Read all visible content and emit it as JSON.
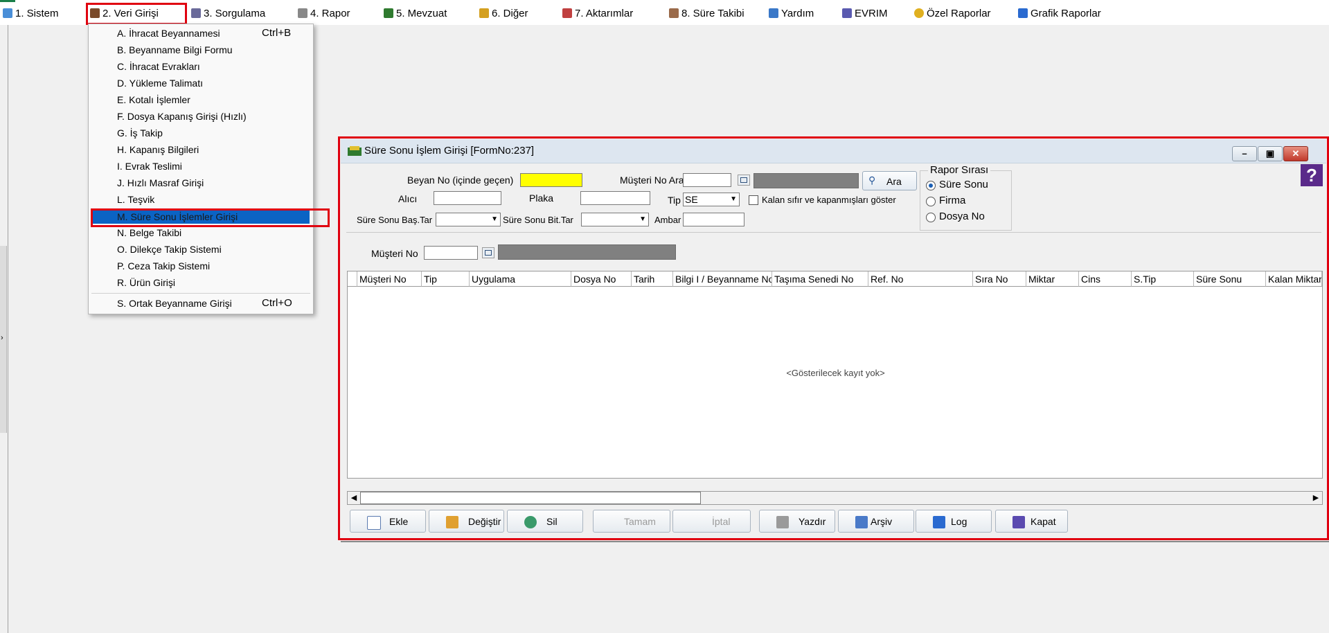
{
  "menubar": {
    "items": [
      {
        "label": "1.   Sistem",
        "icon": "system-icon"
      },
      {
        "label": "2.   Veri Girişi",
        "icon": "data-entry-icon"
      },
      {
        "label": "3.   Sorgulama",
        "icon": "query-icon"
      },
      {
        "label": "4.   Rapor",
        "icon": "printer-icon"
      },
      {
        "label": "5.   Mevzuat",
        "icon": "books-icon"
      },
      {
        "label": "6.   Diğer",
        "icon": "other-icon"
      },
      {
        "label": "7.   Aktarımlar",
        "icon": "transfer-icon"
      },
      {
        "label": "8. Süre Takibi",
        "icon": "calendar-icon"
      },
      {
        "label": "Yardım",
        "icon": "help-icon"
      },
      {
        "label": "EVRIM",
        "icon": "evrim-icon"
      },
      {
        "label": "Özel Raporlar",
        "icon": "star-icon"
      },
      {
        "label": "Grafik Raporlar",
        "icon": "chart-icon"
      }
    ],
    "active_index": 1
  },
  "dropdown": {
    "items": [
      {
        "label": "A.   İhracat Beyannamesi",
        "shortcut": "Ctrl+B"
      },
      {
        "label": "B.   Beyanname Bilgi Formu",
        "shortcut": ""
      },
      {
        "label": "C.   İhracat Evrakları",
        "shortcut": ""
      },
      {
        "label": "D.   Yükleme Talimatı",
        "shortcut": ""
      },
      {
        "label": "E.   Kotalı İşlemler",
        "shortcut": ""
      },
      {
        "label": "F.   Dosya Kapanış Girişi (Hızlı)",
        "shortcut": ""
      },
      {
        "label": "G.   İş Takip",
        "shortcut": ""
      },
      {
        "label": "H.   Kapanış Bilgileri",
        "shortcut": ""
      },
      {
        "label": "I.   Evrak Teslimi",
        "shortcut": ""
      },
      {
        "label": "J.   Hızlı Masraf Girişi",
        "shortcut": ""
      },
      {
        "label": "L.   Teşvik",
        "shortcut": ""
      },
      {
        "label": "M.   Süre Sonu İşlemler Girişi",
        "shortcut": ""
      },
      {
        "label": "N.   Belge Takibi",
        "shortcut": ""
      },
      {
        "label": "O.   Dilekçe Takip Sistemi",
        "shortcut": ""
      },
      {
        "label": "P.   Ceza Takip Sistemi",
        "shortcut": ""
      },
      {
        "label": "R.   Ürün Girişi",
        "shortcut": ""
      },
      {
        "label": "S.   Ortak Beyanname Girişi",
        "shortcut": "Ctrl+O"
      }
    ],
    "selected_index": 11
  },
  "window": {
    "title": "Süre Sonu İşlem Girişi [FormNo:237]",
    "controls": {
      "minimize": "–",
      "maximize": "▣",
      "close": "✕"
    },
    "form": {
      "beyan_no_label": "Beyan No (içinde geçen)",
      "beyan_no_value": "",
      "musteri_no_ara_label": "Müşteri No Ara",
      "ara_button": "Ara",
      "alici_label": "Alıcı",
      "plaka_label": "Plaka",
      "tip_label": "Tip",
      "tip_value": "SE",
      "kalan_checkbox_label": "Kalan sıfır ve kapanmışları göster",
      "sure_sonu_bas_label": "Süre Sonu Baş.Tar",
      "sure_sonu_bit_label": "Süre Sonu Bit.Tar",
      "ambar_label": "Ambar",
      "musteri_no_label": "Müşteri No",
      "rapor_sirasi": {
        "title": "Rapor Sırası",
        "options": [
          "Süre Sonu",
          "Firma",
          "Dosya No"
        ],
        "selected_index": 0
      },
      "help_glyph": "?"
    },
    "grid": {
      "columns": [
        "Müşteri No",
        "Tip",
        "Uygulama",
        "Dosya No",
        "Tarih",
        "Bilgi I / Beyanname No",
        "Taşıma Senedi No",
        "Ref. No",
        "Sıra No",
        "Miktar",
        "Cins",
        "S.Tip",
        "Süre Sonu",
        "Kalan Miktar"
      ],
      "empty_message": "<Gösterilecek kayıt yok>"
    },
    "buttons": [
      {
        "label": "Ekle",
        "enabled": true
      },
      {
        "label": "Değiştir",
        "enabled": true
      },
      {
        "label": "Sil",
        "enabled": true
      },
      {
        "label": "Tamam",
        "enabled": false
      },
      {
        "label": "İptal",
        "enabled": false
      },
      {
        "label": "Yazdır",
        "enabled": true
      },
      {
        "label": "Arşiv",
        "enabled": true
      },
      {
        "label": "Log",
        "enabled": true
      },
      {
        "label": "Kapat",
        "enabled": true
      }
    ]
  },
  "colors": {
    "highlight_red": "#e0000f",
    "selection_blue": "#0b63c4",
    "input_yellow": "#ffff00",
    "title_bar": "#dde6f0"
  }
}
